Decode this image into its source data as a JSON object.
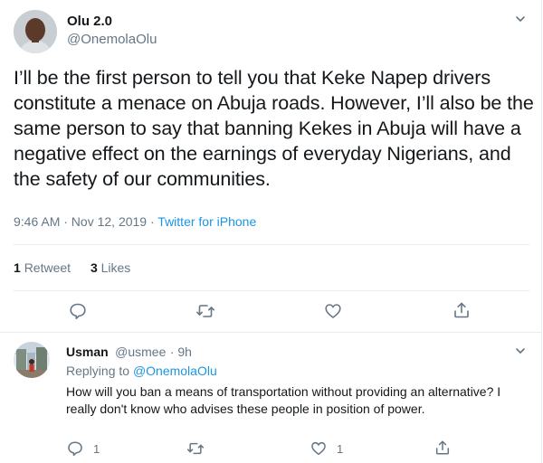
{
  "tweet": {
    "author_name": "Olu 2.0",
    "author_handle": "@OnemolaOlu",
    "text": "I’ll be the first person to tell you that Keke Napep drivers constitute a menace on Abuja roads. However, I’ll also be the same person to say that banning Kekes in Abuja will have a negative effect on the earnings of everyday Nigerians, and the safety of our communities.",
    "time": "9:46 AM · Nov 12, 2019",
    "separator": " · ",
    "client": "Twitter for iPhone",
    "retweet_count": "1",
    "retweet_label": "Retweet",
    "like_count": "3",
    "like_label": "Likes"
  },
  "reply": {
    "author_name": "Usman",
    "author_handle": "@usmee",
    "age": "· 9h",
    "replying_label": "Replying to",
    "replying_to": "@OnemolaOlu",
    "text": "How will you ban a means of transportation without providing an alternative? I really don't know who advises these people in position of power.",
    "reply_count": "1",
    "like_count": "1"
  },
  "icons": {
    "menu": "chevron-down-icon",
    "reply": "speech-bubble-icon",
    "retweet": "retweet-arrows-icon",
    "like": "heart-icon",
    "share": "share-upload-icon"
  },
  "colors": {
    "link": "#1b95e0",
    "secondary_text": "#657786",
    "primary_text": "#14171a",
    "divider": "#e6ecf0"
  }
}
